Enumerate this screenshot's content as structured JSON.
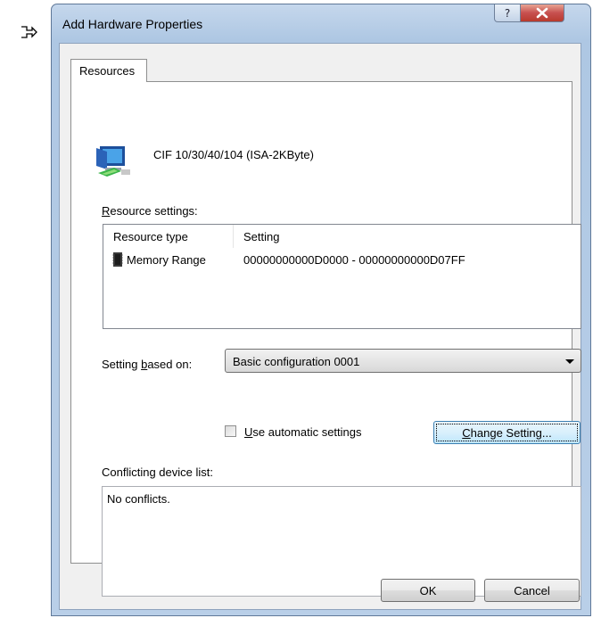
{
  "window": {
    "title": "Add Hardware Properties",
    "help_glyph": "?",
    "close_glyph": "x"
  },
  "tabs": [
    {
      "label": "Resources"
    }
  ],
  "device": {
    "name": "CIF 10/30/40/104 (ISA-2KByte)"
  },
  "resource_settings": {
    "label_accel": "R",
    "label_rest": "esource settings:",
    "columns": [
      "Resource type",
      "Setting"
    ],
    "rows": [
      {
        "type": "Memory Range",
        "setting": "00000000000D0000 - 00000000000D07FF",
        "icon": "memory-chip-icon"
      }
    ]
  },
  "setting_based_on": {
    "label_pre": "Setting ",
    "label_accel": "b",
    "label_post": "ased on:",
    "value": "Basic configuration 0001"
  },
  "auto_settings": {
    "label_accel": "U",
    "label_rest": "se automatic settings",
    "checked": false
  },
  "change_setting": {
    "label_accel": "C",
    "label_rest": "hange Setting..."
  },
  "conflicts": {
    "label": "Conflicting device list:",
    "text": "No conflicts."
  },
  "buttons": {
    "ok": "OK",
    "cancel": "Cancel"
  },
  "colors": {
    "title_bar": "#b9d1ea",
    "close_button": "#c75050",
    "focus_button": "#bee6fd"
  }
}
